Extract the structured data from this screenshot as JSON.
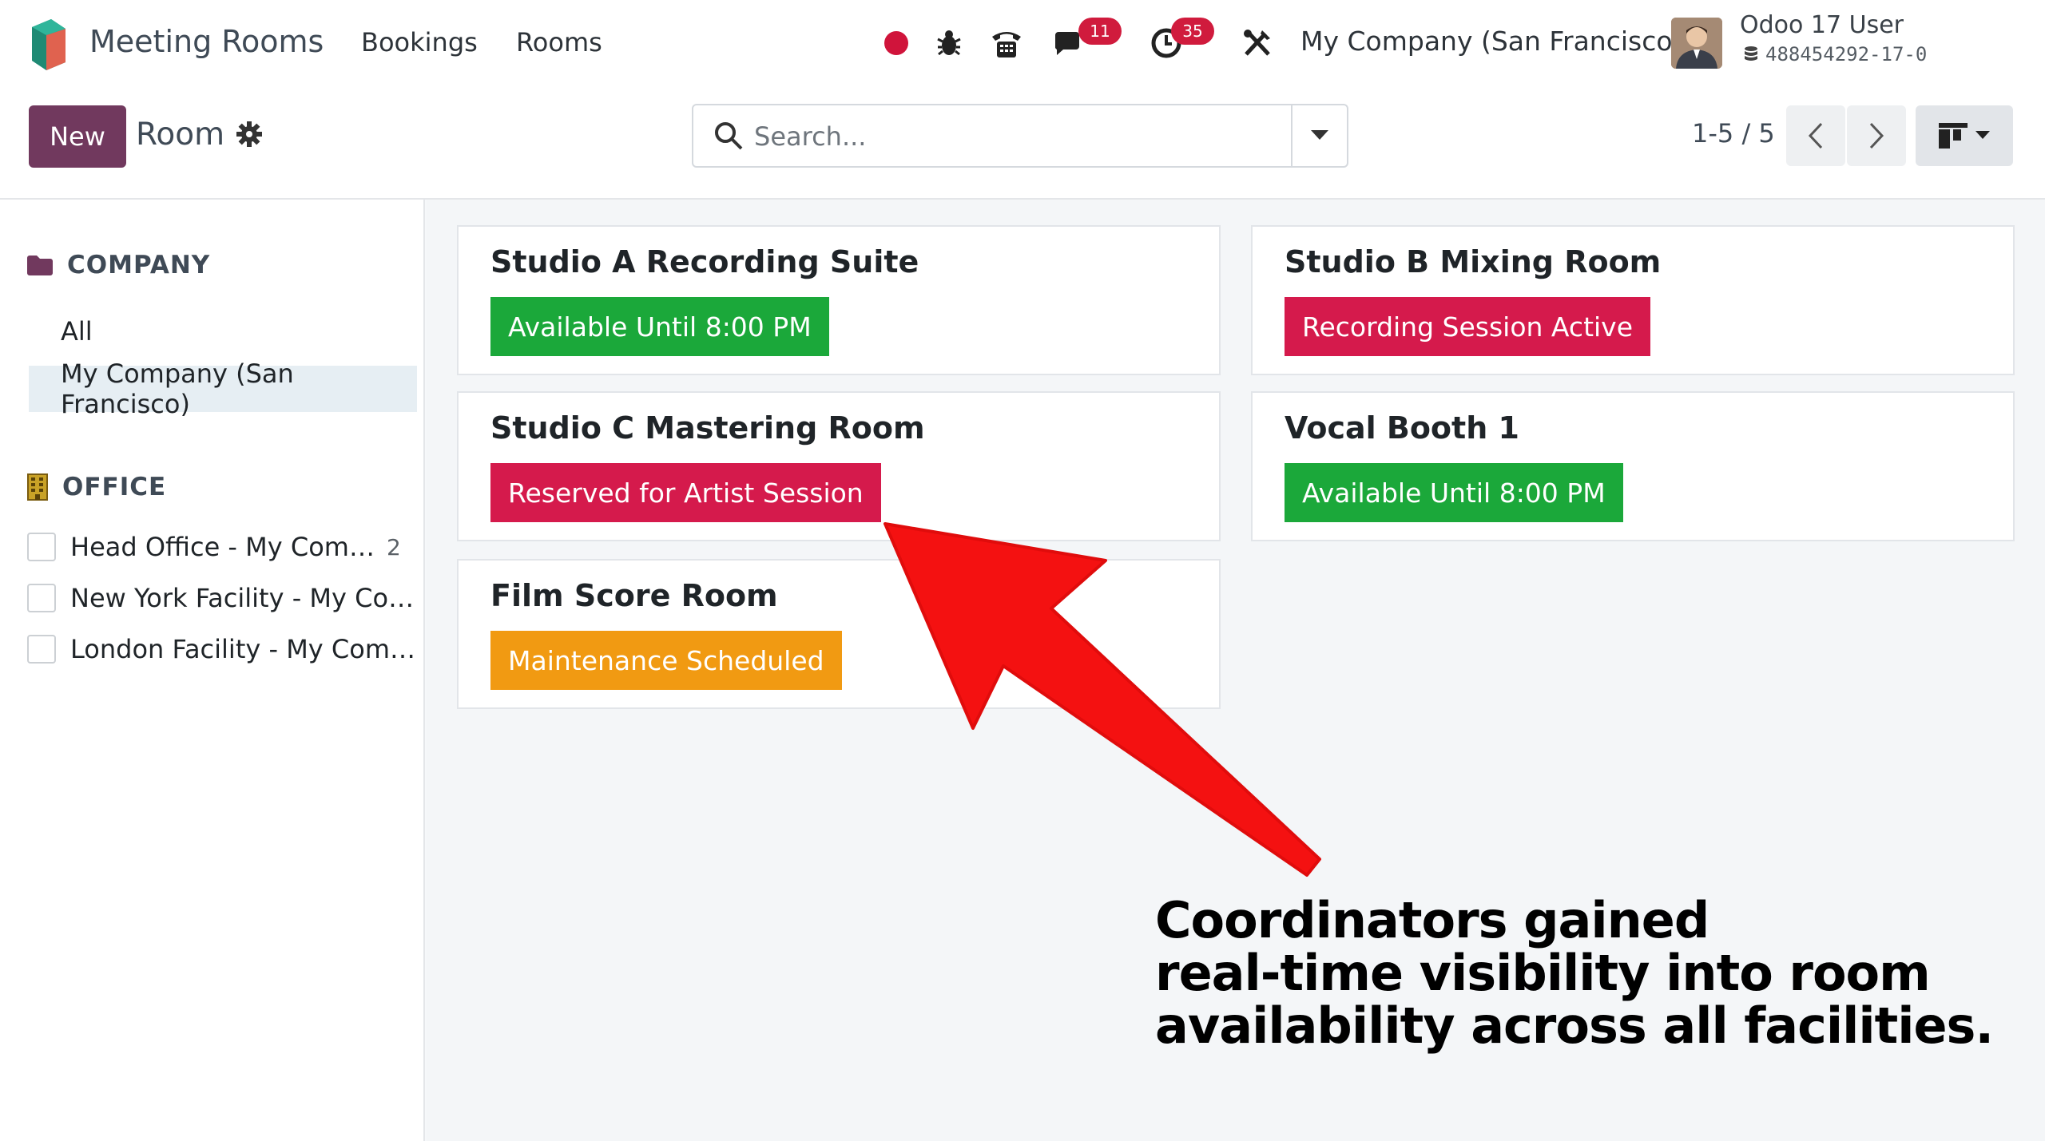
{
  "navbar": {
    "app_name": "Meeting Rooms",
    "menus": [
      "Bookings",
      "Rooms"
    ],
    "chat_badge": "11",
    "activity_badge": "35",
    "company": "My Company (San Francisco)",
    "user_name": "Odoo 17 User",
    "db_name": "488454292-17-0",
    "colors": {
      "record_dot": "#d0143b",
      "badge": "#d01b3d"
    }
  },
  "control": {
    "new_label": "New",
    "title": "Room",
    "search_placeholder": "Search...",
    "pager": "1-5 / 5"
  },
  "sidebar": {
    "company_heading": "COMPANY",
    "company_filters": [
      "All",
      "My Company (San Francisco)"
    ],
    "office_heading": "OFFICE",
    "offices": [
      {
        "label": "Head Office - My Com…",
        "count": "2"
      },
      {
        "label": "New York Facility - My Com…",
        "count": ""
      },
      {
        "label": "London Facility - My Com…",
        "count": ""
      }
    ]
  },
  "rooms": [
    {
      "name": "Studio A Recording Suite",
      "status": "Available Until 8:00 PM",
      "color": "green"
    },
    {
      "name": "Studio B Mixing Room",
      "status": "Recording Session Active",
      "color": "red"
    },
    {
      "name": "Studio C Mastering Room",
      "status": "Reserved for Artist Session",
      "color": "red"
    },
    {
      "name": "Vocal Booth 1",
      "status": "Available Until 8:00 PM",
      "color": "green"
    },
    {
      "name": "Film Score Room",
      "status": "Maintenance Scheduled",
      "color": "orange"
    }
  ],
  "annotation": {
    "lines": [
      "Coordinators gained",
      "real-time visibility into room",
      "availability across all facilities."
    ],
    "arrow_color": "#f41111"
  }
}
